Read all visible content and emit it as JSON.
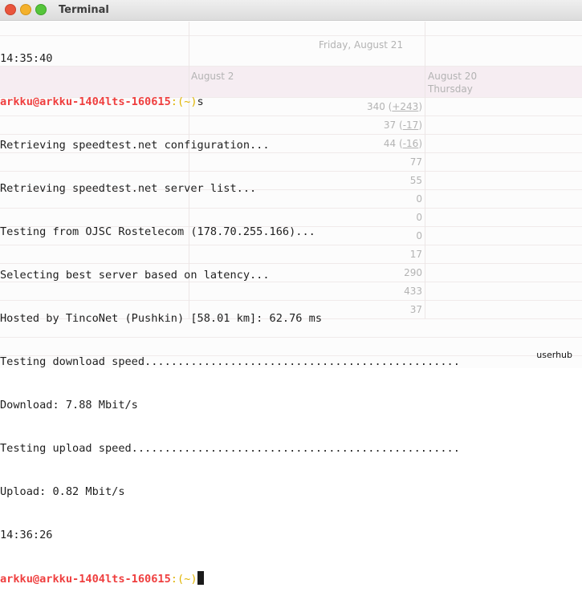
{
  "window": {
    "title": "Terminal"
  },
  "background_calendar": {
    "date_header_1": "Friday, August 21",
    "date_header_2_date": "August 20",
    "date_header_2_day": "Thursday",
    "date_header_3": "August 2",
    "numbers": [
      {
        "value": "340",
        "delta": "+243"
      },
      {
        "value": "37",
        "delta": "-17"
      },
      {
        "value": "44",
        "delta": "-16"
      },
      {
        "value": "77",
        "delta": ""
      },
      {
        "value": "55",
        "delta": ""
      },
      {
        "value": "0",
        "delta": ""
      },
      {
        "value": "0",
        "delta": ""
      },
      {
        "value": "0",
        "delta": ""
      },
      {
        "value": "17",
        "delta": ""
      },
      {
        "value": "290",
        "delta": ""
      },
      {
        "value": "433",
        "delta": ""
      },
      {
        "value": "37",
        "delta": ""
      }
    ]
  },
  "terminal": {
    "time_start": "14:35:40",
    "prompt_user": "arkku@arkku-1404lts-160615",
    "prompt_sep": ":",
    "prompt_dir": "(~)",
    "command": "s",
    "out_1": "Retrieving speedtest.net configuration...",
    "out_2": "Retrieving speedtest.net server list...",
    "out_3": "Testing from OJSC Rostelecom (178.70.255.166)...",
    "out_4": "Selecting best server based on latency...",
    "out_5": "Hosted by TincoNet (Pushkin) [58.01 km]: 62.76 ms",
    "out_6": "Testing download speed................................................",
    "out_7": "Download: 7.88 Mbit/s",
    "out_8": "Testing upload speed..................................................",
    "out_9": "Upload: 0.82 Mbit/s",
    "time_end": "14:36:26"
  },
  "watermark": "userhub"
}
